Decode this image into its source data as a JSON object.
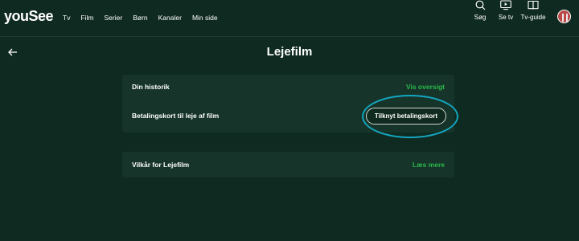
{
  "header": {
    "logo": "youSee",
    "nav": [
      "Tv",
      "Film",
      "Serier",
      "Børn",
      "Kanaler",
      "Min side"
    ],
    "tools": {
      "search": "Søg",
      "watch_tv": "Se tv",
      "tv_guide": "Tv-guide"
    }
  },
  "page": {
    "title": "Lejefilm"
  },
  "card1": {
    "history_label": "Din historik",
    "history_link": "Vis oversigt",
    "payment_label": "Betalingskort til leje af film",
    "payment_button": "Tilknyt betalingskort"
  },
  "card2": {
    "terms_label": "Vilkår for Lejefilm",
    "terms_link": "Læs mere"
  },
  "colors": {
    "background": "#0f2a20",
    "card": "#16342a",
    "link_green": "#2bb94a",
    "highlight_ring": "#14a6c0"
  }
}
